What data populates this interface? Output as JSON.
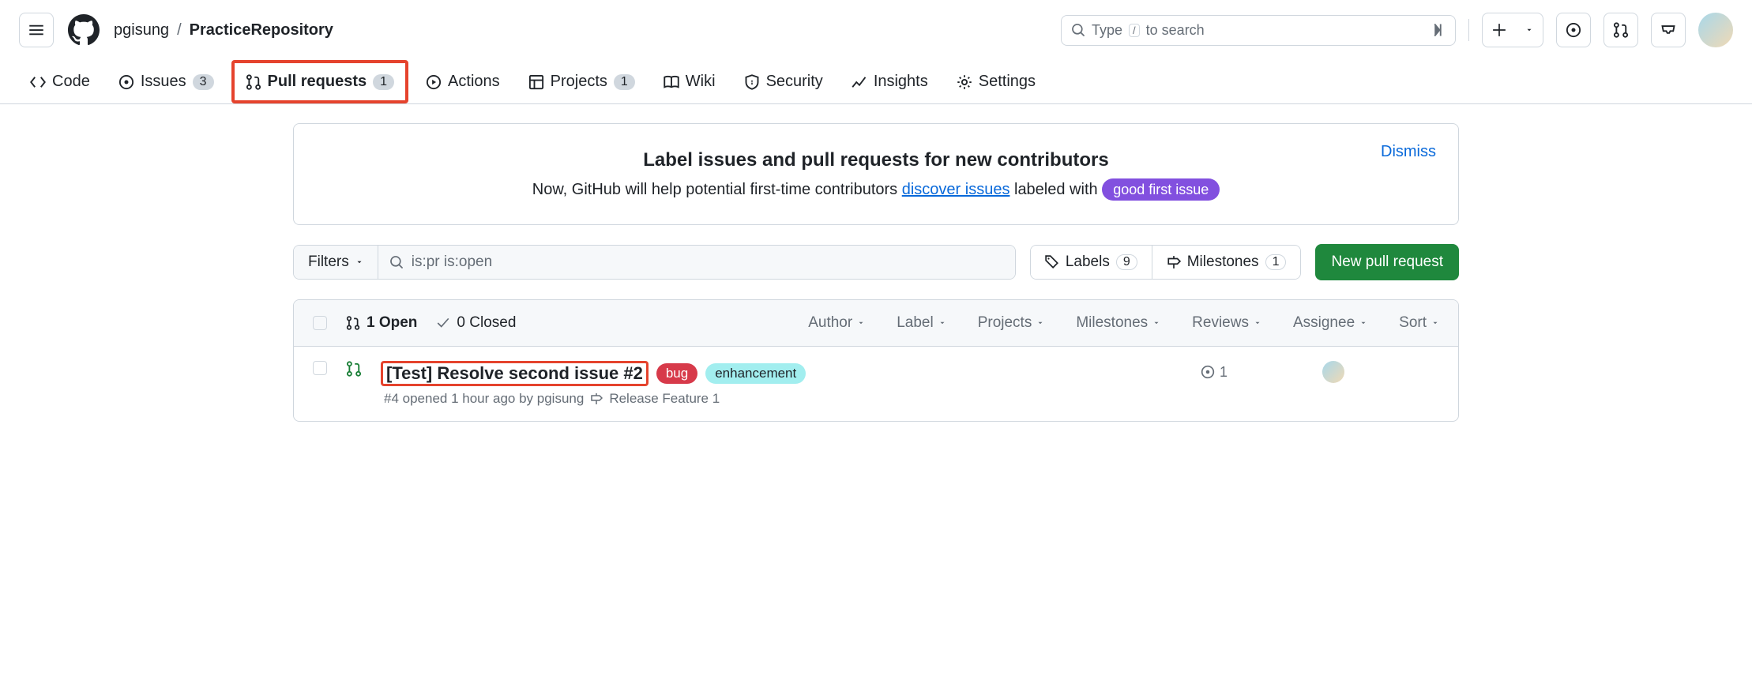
{
  "header": {
    "owner": "pgisung",
    "separator": "/",
    "repo": "PracticeRepository",
    "search_placeholder_pre": "Type",
    "search_kbd": "/",
    "search_placeholder_post": "to search"
  },
  "nav": {
    "code": "Code",
    "issues": "Issues",
    "issues_count": "3",
    "pull_requests": "Pull requests",
    "pull_requests_count": "1",
    "actions": "Actions",
    "projects": "Projects",
    "projects_count": "1",
    "wiki": "Wiki",
    "security": "Security",
    "insights": "Insights",
    "settings": "Settings"
  },
  "banner": {
    "title": "Label issues and pull requests for new contributors",
    "text_pre": "Now, GitHub will help potential first-time contributors ",
    "link": "discover issues",
    "text_mid": " labeled with ",
    "pill": "good first issue",
    "dismiss": "Dismiss"
  },
  "toolbar": {
    "filters": "Filters",
    "search_value": "is:pr is:open",
    "labels": "Labels",
    "labels_count": "9",
    "milestones": "Milestones",
    "milestones_count": "1",
    "new_pr": "New pull request"
  },
  "list": {
    "open": "1 Open",
    "closed": "0 Closed",
    "filters": {
      "author": "Author",
      "label": "Label",
      "projects": "Projects",
      "milestones": "Milestones",
      "reviews": "Reviews",
      "assignee": "Assignee",
      "sort": "Sort"
    },
    "items": [
      {
        "title": "[Test] Resolve second issue #2",
        "labels": {
          "bug": "bug",
          "enhancement": "enhancement"
        },
        "meta": "#4 opened 1 hour ago by pgisung",
        "milestone": "Release Feature 1",
        "linked_issues": "1"
      }
    ]
  }
}
